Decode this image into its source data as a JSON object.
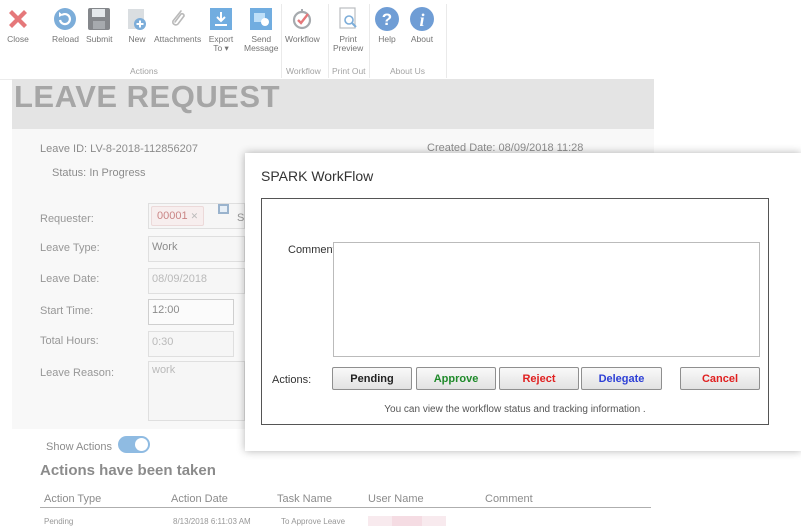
{
  "toolbar": {
    "close": "Close",
    "reload": "Reload",
    "submit": "Submit",
    "new": "New",
    "attachments": "Attachments",
    "export_line1": "Export",
    "export_line2": "To ▾",
    "send_line1": "Send",
    "send_line2": "Message",
    "workflow": "Workflow",
    "print_line1": "Print",
    "print_line2": "Preview",
    "help": "Help",
    "about": "About",
    "groups": {
      "actions": "Actions",
      "workflow": "Workflow",
      "print_out": "Print Out",
      "about_us": "About Us"
    },
    "colors": {
      "close_red": "#d9383c",
      "reload_blue": "#3f86c7",
      "submit_dark": "#4b4f54",
      "new_gray": "#9aa3ab",
      "blue_tile": "#2f86d1",
      "help_blue": "#2b6fc2"
    }
  },
  "form": {
    "title": "LEAVE REQUEST",
    "leave_id_label": "Leave ID:",
    "leave_id": "LV-8-2018-112856207",
    "status_label": "Status:",
    "status": "In Progress",
    "created_label": "Created Date:",
    "created_date": "08/09/2018 11:28",
    "requester_label": "Requester:",
    "requester_chip": "00001",
    "requester_partial": "S",
    "leave_type_label": "Leave Type:",
    "leave_type": "Work",
    "leave_date_label": "Leave Date:",
    "leave_date": "08/09/2018",
    "start_time_label": "Start Time:",
    "start_time": "12:00",
    "total_hours_label": "Total Hours:",
    "total_hours": "0:30",
    "reason_label": "Leave Reason:",
    "reason": "work",
    "show_actions_label": "Show Actions",
    "show_actions_on": true
  },
  "actions_taken": {
    "title": "Actions have been taken",
    "columns": [
      "Action Type",
      "Action Date",
      "Task Name",
      "User Name",
      "Comment"
    ],
    "rows": [
      {
        "action_type": "Pending",
        "action_date": "8/13/2018 6:11:03 AM",
        "task_name": "To Approve Leave",
        "user_name": "",
        "comment": ""
      }
    ]
  },
  "dialog": {
    "title": "SPARK WorkFlow",
    "comment_label": "Comment:",
    "comment_value": "",
    "actions_label": "Actions:",
    "buttons": {
      "pending": "Pending",
      "approve": "Approve",
      "reject": "Reject",
      "delegate": "Delegate",
      "cancel": "Cancel"
    },
    "button_colors": {
      "pending": "#222222",
      "approve": "#1f8a2a",
      "reject": "#e02020",
      "delegate": "#2d3fd6",
      "cancel": "#e02020"
    },
    "info": "You can view the workflow status and tracking information ."
  }
}
